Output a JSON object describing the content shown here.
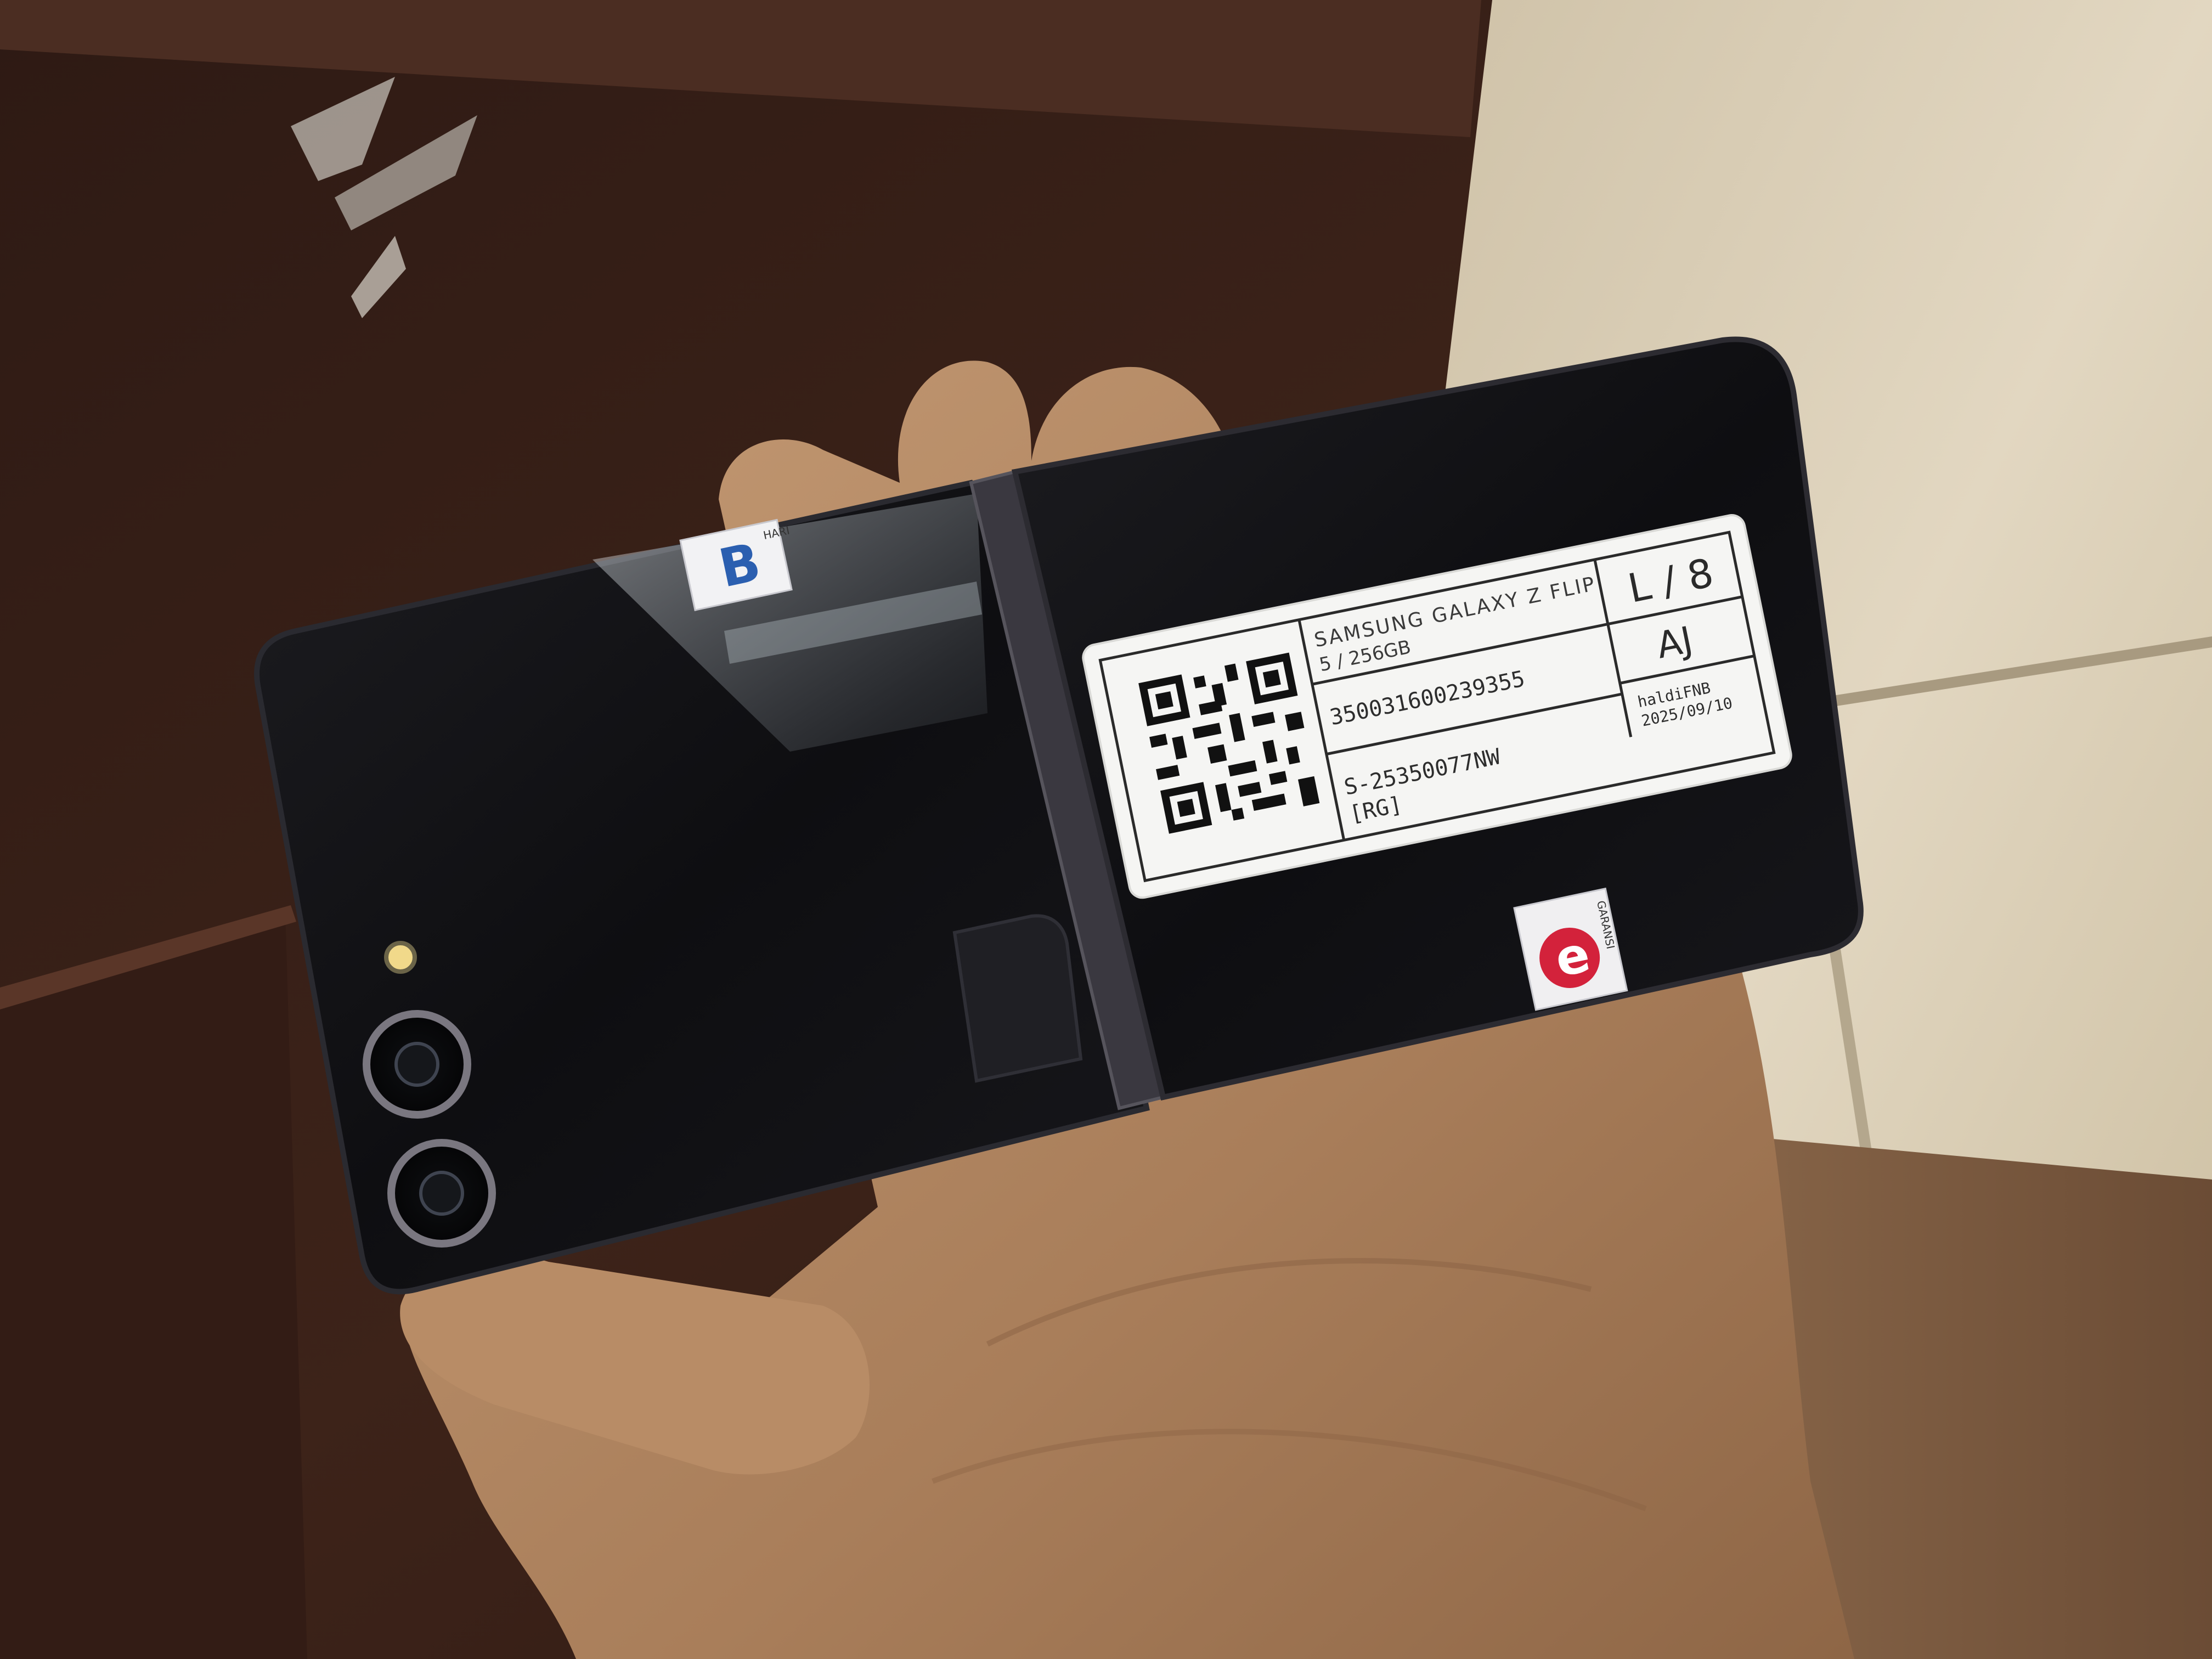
{
  "photo": {
    "subject": "Samsung Galaxy Z Flip smartphone (closed) held in a hand, with an inventory sticker",
    "colors": {
      "wood_panel": "#3a2118",
      "tile_floor": "#d8ccb4",
      "phone_body": "#111114",
      "skin": "#b48b66",
      "sticker_bg": "#f4f4f2"
    }
  },
  "sticker": {
    "model_line1": "SAMSUNG GALAXY Z FLIP",
    "model_line2": "5 / 256GB",
    "imei": "350031600239355",
    "serial_line1": "S-25350077NW",
    "serial_line2": "[RG]",
    "grade": "L / 8",
    "code": "AJ",
    "checker": "haldiFNB",
    "date": "2025/09/10"
  },
  "warranty_labels": {
    "left_tag": "B",
    "left_tag_side": "HARI",
    "right_tag": "e",
    "right_tag_side": "GARANSI"
  }
}
